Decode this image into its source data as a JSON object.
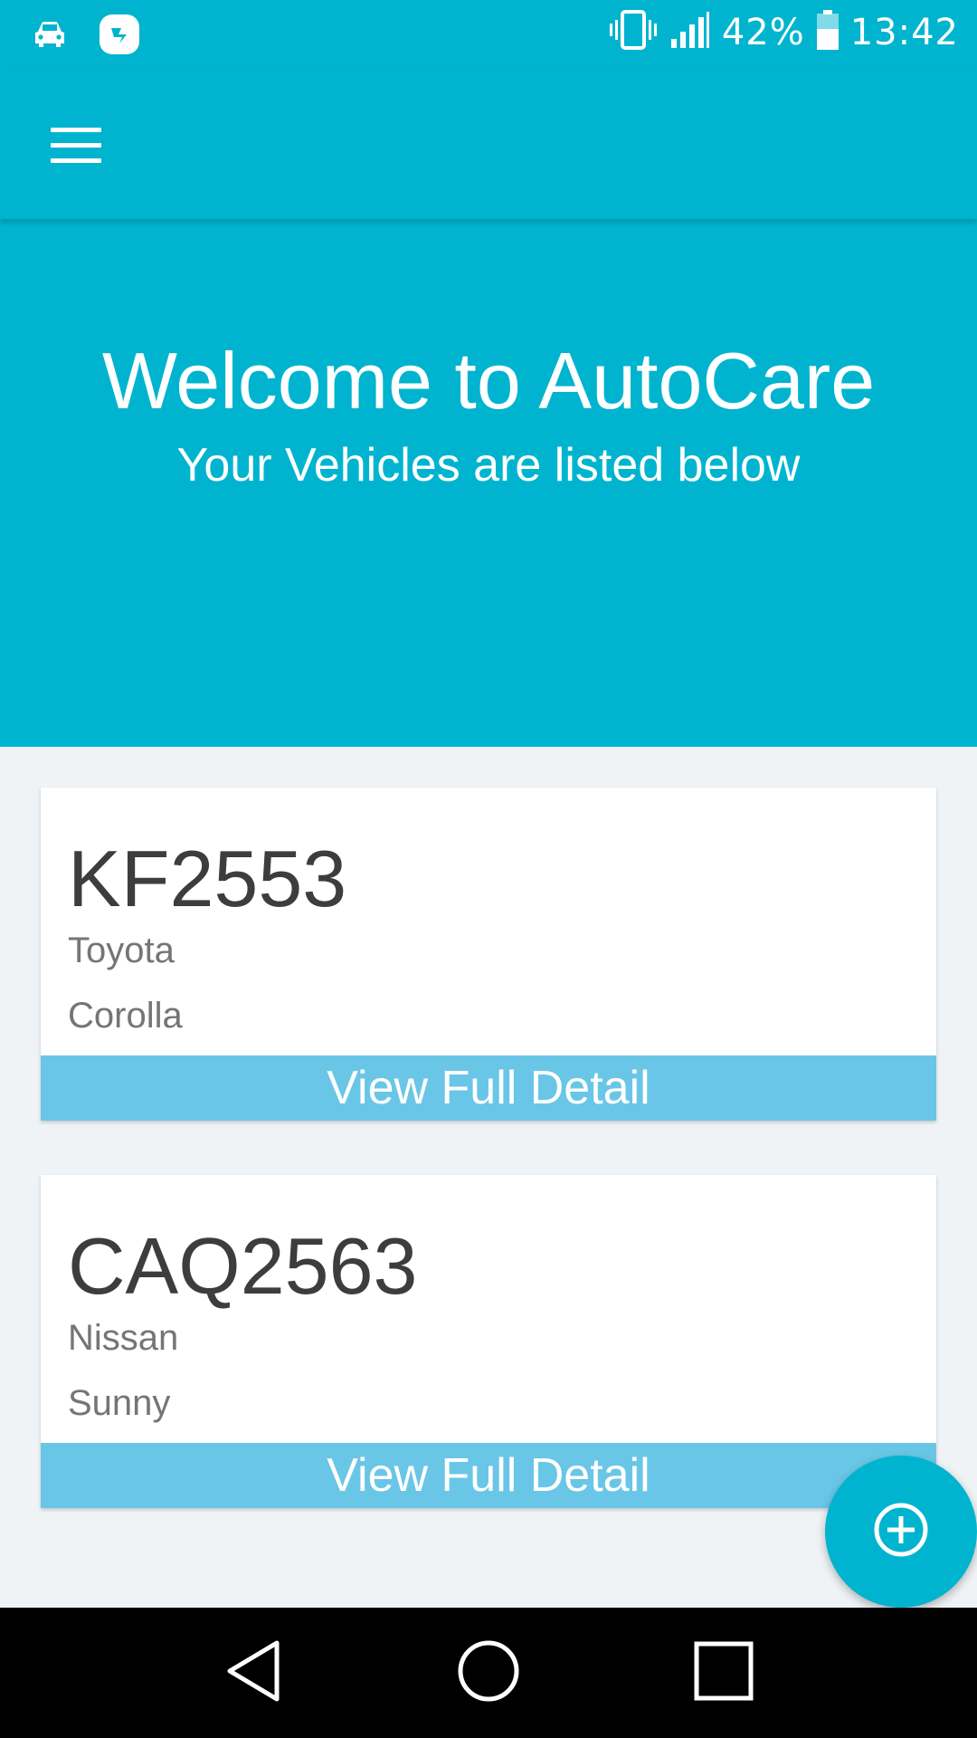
{
  "status_bar": {
    "battery_percent": "42%",
    "time": "13:42",
    "icons": [
      "car-icon",
      "app-notification-icon",
      "vibrate-icon",
      "signal-icon",
      "battery-icon"
    ]
  },
  "app_bar": {
    "menu_icon": "hamburger-menu-icon"
  },
  "hero": {
    "title": "Welcome to AutoCare",
    "subtitle": "Your Vehicles are listed below"
  },
  "vehicles": [
    {
      "plate": "KF2553",
      "make": "Toyota",
      "model": "Corolla",
      "button_label": "View Full Detail"
    },
    {
      "plate": "CAQ2563",
      "make": "Nissan",
      "model": "Sunny",
      "button_label": "View Full Detail"
    }
  ],
  "fab": {
    "icon": "add-circle-icon"
  },
  "nav_bar": {
    "icons": [
      "back-icon",
      "home-icon",
      "recents-icon"
    ]
  },
  "colors": {
    "primary": "#00b4cf",
    "button": "#6ac6e6",
    "background": "#eff3f6",
    "card": "#ffffff",
    "plate_text": "#3d3d3d",
    "secondary_text": "#757575"
  }
}
